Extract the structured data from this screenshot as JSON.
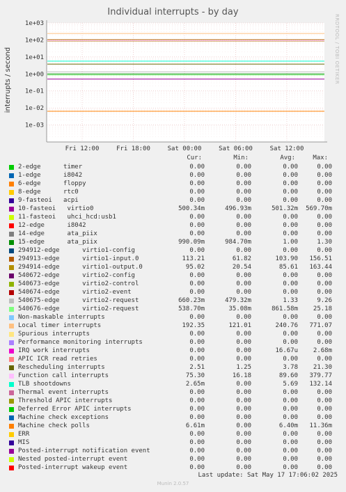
{
  "chart_data": {
    "type": "line",
    "title": "Individual interrupts - by day",
    "ylabel": "interrupts / second",
    "yscale": "log",
    "ylim": [
      0.0001,
      1000
    ],
    "yticks": [
      "1e+03",
      "1e+02",
      "1e+01",
      "1e+00",
      "1e-01",
      "1e-02",
      "1e-03"
    ],
    "xticks": [
      "Fri 12:00",
      "Fri 18:00",
      "Sat 00:00",
      "Sat 06:00",
      "Sat 12:00"
    ],
    "columns": [
      "Cur:",
      "Min:",
      "Avg:",
      "Max:"
    ],
    "grid": true,
    "series": [
      {
        "name": "2-edge      timer",
        "color": "#00cc00",
        "values": [
          "0.00",
          "0.00",
          "0.00",
          "0.00"
        ]
      },
      {
        "name": "1-edge      i8042",
        "color": "#0066b3",
        "values": [
          "0.00",
          "0.00",
          "0.00",
          "0.00"
        ]
      },
      {
        "name": "6-edge      floppy",
        "color": "#ff8000",
        "values": [
          "0.00",
          "0.00",
          "0.00",
          "0.00"
        ]
      },
      {
        "name": "8-edge      rtc0",
        "color": "#ffcc00",
        "values": [
          "0.00",
          "0.00",
          "0.00",
          "0.00"
        ]
      },
      {
        "name": "9-fasteoi   acpi",
        "color": "#330099",
        "values": [
          "0.00",
          "0.00",
          "0.00",
          "0.00"
        ]
      },
      {
        "name": "10-fasteoi   virtio0",
        "color": "#990099",
        "values": [
          "500.34m",
          "496.93m",
          "501.32m",
          "569.70m"
        ]
      },
      {
        "name": "11-fasteoi   uhci_hcd:usb1",
        "color": "#ccff00",
        "values": [
          "0.00",
          "0.00",
          "0.00",
          "0.00"
        ]
      },
      {
        "name": "12-edge      i8042",
        "color": "#ff0000",
        "values": [
          "0.00",
          "0.00",
          "0.00",
          "0.00"
        ]
      },
      {
        "name": "14-edge      ata_piix",
        "color": "#808080",
        "values": [
          "0.00",
          "0.00",
          "0.00",
          "0.00"
        ]
      },
      {
        "name": "15-edge      ata_piix",
        "color": "#008f00",
        "values": [
          "990.09m",
          "984.70m",
          "1.00",
          "1.30"
        ]
      },
      {
        "name": "294912-edge      virtio1-config",
        "color": "#00487d",
        "values": [
          "0.00",
          "0.00",
          "0.00",
          "0.00"
        ]
      },
      {
        "name": "294913-edge      virtio1-input.0",
        "color": "#b35a00",
        "values": [
          "113.21",
          "61.82",
          "103.90",
          "156.51"
        ]
      },
      {
        "name": "294914-edge      virtio1-output.0",
        "color": "#b38f00",
        "values": [
          "95.02",
          "20.54",
          "85.61",
          "163.44"
        ]
      },
      {
        "name": "540672-edge      virtio2-config",
        "color": "#6b006b",
        "values": [
          "0.00",
          "0.00",
          "0.00",
          "0.00"
        ]
      },
      {
        "name": "540673-edge      virtio2-control",
        "color": "#8fb300",
        "values": [
          "0.00",
          "0.00",
          "0.00",
          "0.00"
        ]
      },
      {
        "name": "540674-edge      virtio2-event",
        "color": "#b30000",
        "values": [
          "0.00",
          "0.00",
          "0.00",
          "0.00"
        ]
      },
      {
        "name": "540675-edge      virtio2-request",
        "color": "#bebebe",
        "values": [
          "660.23m",
          "479.32m",
          "1.33",
          "9.26"
        ]
      },
      {
        "name": "540676-edge      virtio2-request",
        "color": "#80ff80",
        "values": [
          "538.70m",
          "35.08m",
          "861.58m",
          "25.18"
        ]
      },
      {
        "name": "Non-maskable interrupts",
        "color": "#80c9ff",
        "values": [
          "0.00",
          "0.00",
          "0.00",
          "0.00"
        ]
      },
      {
        "name": "Local timer interrupts",
        "color": "#ffc080",
        "values": [
          "192.35",
          "121.01",
          "240.76",
          "771.07"
        ]
      },
      {
        "name": "Spurious interrupts",
        "color": "#ffe680",
        "values": [
          "0.00",
          "0.00",
          "0.00",
          "0.00"
        ]
      },
      {
        "name": "Performance monitoring interrupts",
        "color": "#aa80ff",
        "values": [
          "0.00",
          "0.00",
          "0.00",
          "0.00"
        ]
      },
      {
        "name": "IRQ work interrupts",
        "color": "#ee00cc",
        "values": [
          "0.00",
          "0.00",
          "16.67u",
          "2.68m"
        ]
      },
      {
        "name": "APIC ICR read retries",
        "color": "#ff8080",
        "values": [
          "0.00",
          "0.00",
          "0.00",
          "0.00"
        ]
      },
      {
        "name": "Rescheduling interrupts",
        "color": "#666600",
        "values": [
          "2.51",
          "1.25",
          "3.78",
          "21.30"
        ]
      },
      {
        "name": "Function call interrupts",
        "color": "#ffbfff",
        "values": [
          "75.30",
          "16.18",
          "89.60",
          "379.77"
        ]
      },
      {
        "name": "TLB shootdowns",
        "color": "#00ffcc",
        "values": [
          "2.65m",
          "0.00",
          "5.69",
          "132.14"
        ]
      },
      {
        "name": "Thermal event interrupts",
        "color": "#cc6699",
        "values": [
          "0.00",
          "0.00",
          "0.00",
          "0.00"
        ]
      },
      {
        "name": "Threshold APIC interrupts",
        "color": "#999900",
        "values": [
          "0.00",
          "0.00",
          "0.00",
          "0.00"
        ]
      },
      {
        "name": "Deferred Error APIC interrupts",
        "color": "#00cc00",
        "values": [
          "0.00",
          "0.00",
          "0.00",
          "0.00"
        ]
      },
      {
        "name": "Machine check exceptions",
        "color": "#0066b3",
        "values": [
          "0.00",
          "0.00",
          "0.00",
          "0.00"
        ]
      },
      {
        "name": "Machine check polls",
        "color": "#ff8000",
        "values": [
          "6.61m",
          "0.00",
          "6.40m",
          "11.36m"
        ]
      },
      {
        "name": "ERR",
        "color": "#ffcc00",
        "values": [
          "0.00",
          "0.00",
          "0.00",
          "0.00"
        ]
      },
      {
        "name": "MIS",
        "color": "#330099",
        "values": [
          "0.00",
          "0.00",
          "0.00",
          "0.00"
        ]
      },
      {
        "name": "Posted-interrupt notification event",
        "color": "#990099",
        "values": [
          "0.00",
          "0.00",
          "0.00",
          "0.00"
        ]
      },
      {
        "name": "Nested posted-interrupt event",
        "color": "#ccff00",
        "values": [
          "0.00",
          "0.00",
          "0.00",
          "0.00"
        ]
      },
      {
        "name": "Posted-interrupt wakeup event",
        "color": "#ff0000",
        "values": [
          "0.00",
          "0.00",
          "0.00",
          "0.00"
        ]
      }
    ]
  },
  "side_label": "RRDTOOL / TOBI OETIKER",
  "last_update": "Last update:  Sat May 17 17:06:02 2025",
  "footer": "Munin 2.0.57"
}
